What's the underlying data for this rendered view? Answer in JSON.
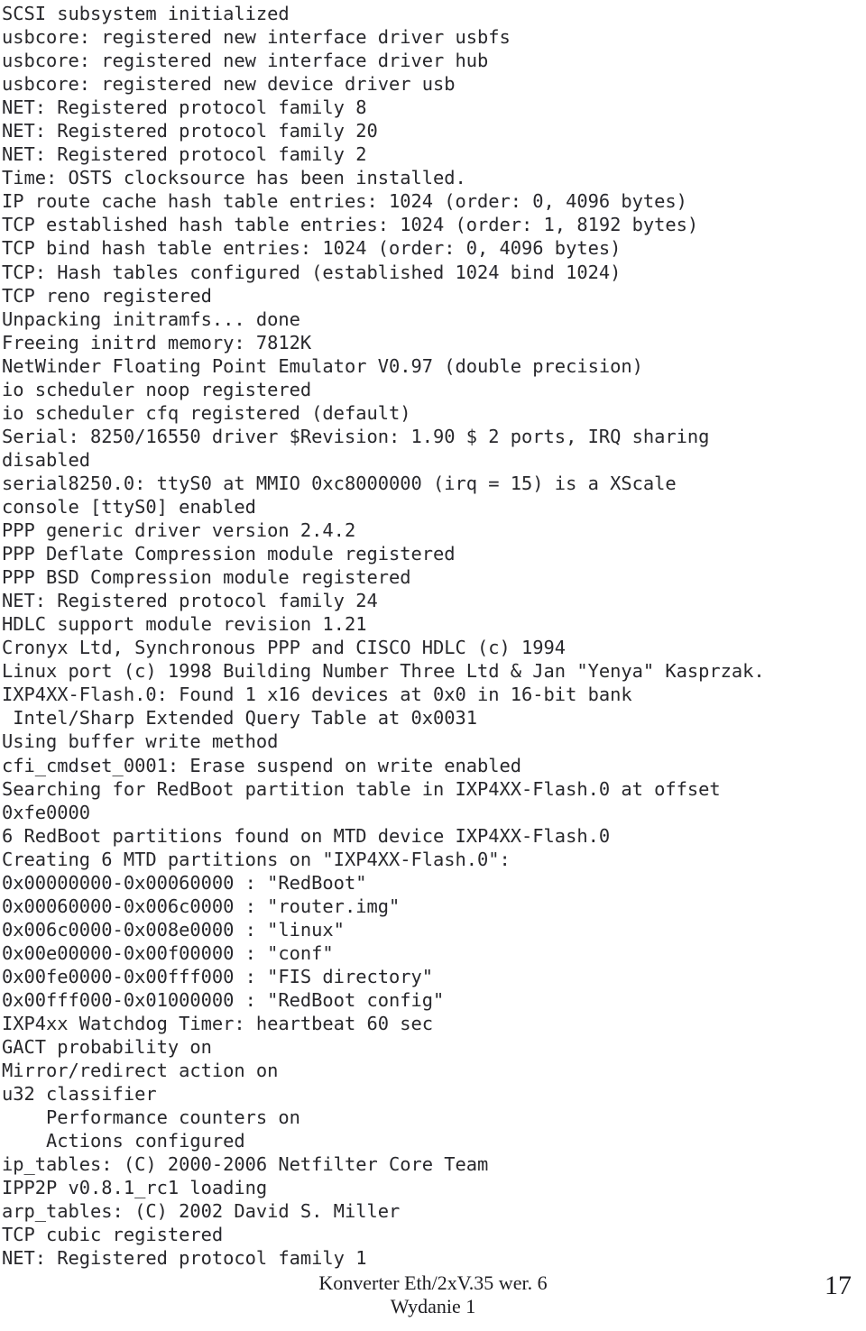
{
  "document": {
    "type": "scanned-manual-page",
    "background_color": "#ffffff",
    "text_color": "#28282c"
  },
  "console": {
    "name": "linux-kernel-boot-log",
    "lines": [
      "SCSI subsystem initialized",
      "usbcore: registered new interface driver usbfs",
      "usbcore: registered new interface driver hub",
      "usbcore: registered new device driver usb",
      "NET: Registered protocol family 8",
      "NET: Registered protocol family 20",
      "NET: Registered protocol family 2",
      "Time: OSTS clocksource has been installed.",
      "IP route cache hash table entries: 1024 (order: 0, 4096 bytes)",
      "TCP established hash table entries: 1024 (order: 1, 8192 bytes)",
      "TCP bind hash table entries: 1024 (order: 0, 4096 bytes)",
      "TCP: Hash tables configured (established 1024 bind 1024)",
      "TCP reno registered",
      "Unpacking initramfs... done",
      "Freeing initrd memory: 7812K",
      "NetWinder Floating Point Emulator V0.97 (double precision)",
      "io scheduler noop registered",
      "io scheduler cfq registered (default)",
      "Serial: 8250/16550 driver $Revision: 1.90 $ 2 ports, IRQ sharing",
      "disabled",
      "serial8250.0: ttyS0 at MMIO 0xc8000000 (irq = 15) is a XScale",
      "console [ttyS0] enabled",
      "PPP generic driver version 2.4.2",
      "PPP Deflate Compression module registered",
      "PPP BSD Compression module registered",
      "NET: Registered protocol family 24",
      "HDLC support module revision 1.21",
      "Cronyx Ltd, Synchronous PPP and CISCO HDLC (c) 1994",
      "Linux port (c) 1998 Building Number Three Ltd & Jan \"Yenya\" Kasprzak.",
      "IXP4XX-Flash.0: Found 1 x16 devices at 0x0 in 16-bit bank",
      " Intel/Sharp Extended Query Table at 0x0031",
      "Using buffer write method",
      "cfi_cmdset_0001: Erase suspend on write enabled",
      "Searching for RedBoot partition table in IXP4XX-Flash.0 at offset",
      "0xfe0000",
      "6 RedBoot partitions found on MTD device IXP4XX-Flash.0",
      "Creating 6 MTD partitions on \"IXP4XX-Flash.0\":",
      "0x00000000-0x00060000 : \"RedBoot\"",
      "0x00060000-0x006c0000 : \"router.img\"",
      "0x006c0000-0x008e0000 : \"linux\"",
      "0x00e00000-0x00f00000 : \"conf\"",
      "0x00fe0000-0x00fff000 : \"FIS directory\"",
      "0x00fff000-0x01000000 : \"RedBoot config\"",
      "IXP4xx Watchdog Timer: heartbeat 60 sec",
      "GACT probability on",
      "Mirror/redirect action on",
      "u32 classifier",
      "    Performance counters on",
      "    Actions configured",
      "ip_tables: (C) 2000-2006 Netfilter Core Team",
      "IPP2P v0.8.1_rc1 loading",
      "arp_tables: (C) 2002 David S. Miller",
      "TCP cubic registered",
      "NET: Registered protocol family 1"
    ]
  },
  "footer": {
    "title_line1": "Konverter Eth/2xV.35 wer. 6",
    "title_line2": "Wydanie 1",
    "page_number": "17"
  }
}
